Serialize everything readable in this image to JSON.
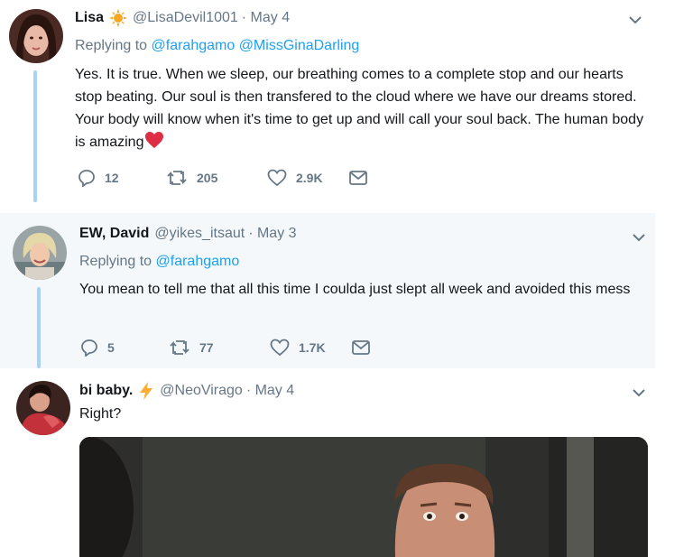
{
  "tweets": [
    {
      "name": "Lisa",
      "handle": "@LisaDevil1001",
      "date": "· May 4",
      "name_emoji": "sun-emoji",
      "replying_prefix": "Replying to",
      "mentions": [
        "@farahgamo",
        "@MissGinaDarling"
      ],
      "text": "Yes. It is true. When we sleep, our breathing comes to a complete stop and our hearts stop beating. Our soul is then transfered to the cloud where we have our dreams stored. Your body will know when it's time to get up and will call your soul back. The human body is amazing",
      "text_emoji": "red-heart-emoji",
      "replies": "12",
      "retweets": "205",
      "likes": "2.9K"
    },
    {
      "name": "EW, David",
      "handle": "@yikes_itsaut",
      "date": "· May 3",
      "replying_prefix": "Replying to",
      "mentions": [
        "@farahgamo"
      ],
      "text": "You mean to tell me that all this time I coulda just slept all week and avoided this mess",
      "replies": "5",
      "retweets": "77",
      "likes": "1.7K"
    },
    {
      "name": "bi baby.",
      "handle": "@NeoVirago",
      "date": "· May 4",
      "name_emoji": "lightning-emoji",
      "text": "Right?"
    }
  ],
  "colors": {
    "accent": "#1da1f2",
    "thread_line": "#a7d4f4",
    "muted": "#657786",
    "highlight_bg": "#f5f8fa",
    "heart": "#e0245e"
  }
}
